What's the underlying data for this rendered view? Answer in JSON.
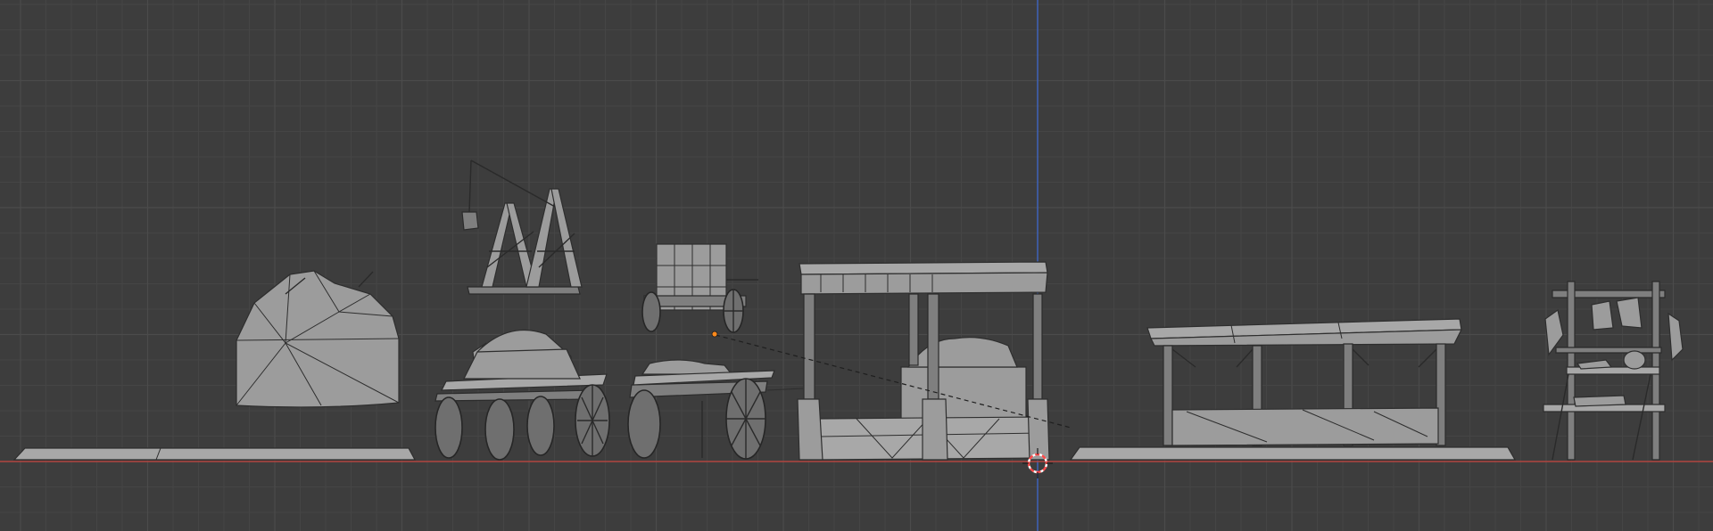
{
  "viewport": {
    "mode": "orthographic-front",
    "colors": {
      "background": "#3d3d3d",
      "grid_minor": "#454545",
      "grid_major": "#4b4b4b",
      "x_axis": "#b0443f",
      "z_axis": "#3f62b8",
      "object": "#9c9c9c",
      "origin": "#ff8a1c",
      "cursor_red": "#ff4b4b",
      "cursor_white": "#ffffff"
    },
    "icons": {
      "cursor": "3d-cursor-icon",
      "origin": "object-origin-icon"
    },
    "objects": [
      "hay-pile",
      "crane",
      "covered-wagon",
      "cage-cart",
      "sack-cart",
      "canopy-bed",
      "market-stall",
      "trophy-rack"
    ]
  }
}
